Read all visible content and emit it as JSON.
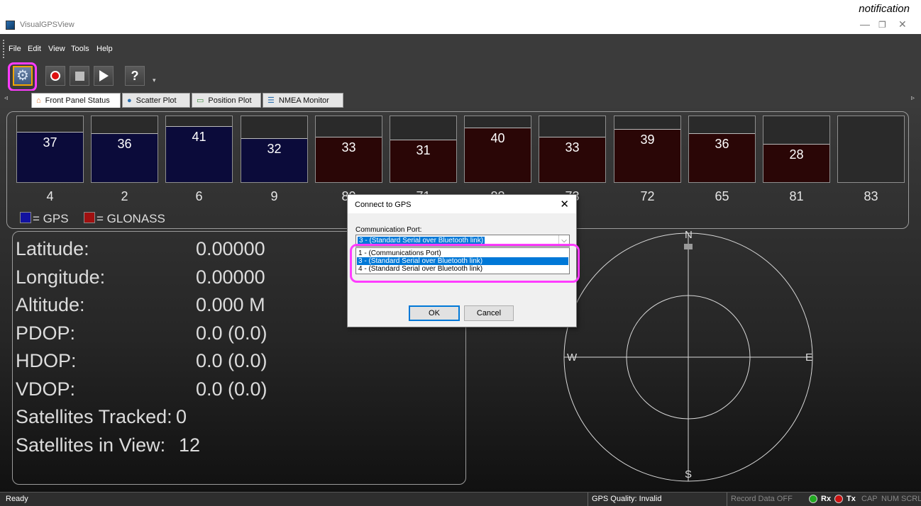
{
  "notification": "notification",
  "window": {
    "title": "VisualGPSView",
    "minimize": "—",
    "restore": "❐",
    "close": "✕"
  },
  "menu": [
    "File",
    "Edit",
    "View",
    "Tools",
    "Help"
  ],
  "toolbar": [
    {
      "name": "settings-icon",
      "glyph": "⚙"
    },
    {
      "name": "record-icon",
      "glyph": "●"
    },
    {
      "name": "stop-icon",
      "glyph": "■"
    },
    {
      "name": "play-icon",
      "glyph": "▶"
    },
    {
      "name": "help-icon",
      "glyph": "?"
    }
  ],
  "tabs": [
    "Front Panel Status",
    "Scatter Plot",
    "Position Plot",
    "NMEA Monitor"
  ],
  "satellites": [
    {
      "id": "4",
      "snr": 37,
      "system": "GPS"
    },
    {
      "id": "2",
      "snr": 36,
      "system": "GPS"
    },
    {
      "id": "6",
      "snr": 41,
      "system": "GPS"
    },
    {
      "id": "9",
      "snr": 32,
      "system": "GPS"
    },
    {
      "id": "80",
      "snr": 33,
      "system": "GLONASS"
    },
    {
      "id": "71",
      "snr": 31,
      "system": "GLONASS"
    },
    {
      "id": "88",
      "snr": 40,
      "system": "GLONASS"
    },
    {
      "id": "73",
      "snr": 33,
      "system": "GLONASS"
    },
    {
      "id": "72",
      "snr": 39,
      "system": "GLONASS"
    },
    {
      "id": "65",
      "snr": 36,
      "system": "GLONASS"
    },
    {
      "id": "81",
      "snr": 28,
      "system": "GLONASS"
    },
    {
      "id": "83",
      "snr": null,
      "system": "GLONASS"
    }
  ],
  "legend": {
    "gps": "= GPS",
    "glonass": "= GLONASS",
    "gps_color": "#0b0b3a",
    "glonass_color": "#2a0606"
  },
  "info": [
    {
      "label": "Latitude:",
      "value": "0.00000"
    },
    {
      "label": "Longitude:",
      "value": "0.00000"
    },
    {
      "label": "Altitude:",
      "value": "0.000 M"
    },
    {
      "label": "PDOP:",
      "value": "0.0 (0.0)"
    },
    {
      "label": "HDOP:",
      "value": "0.0 (0.0)"
    },
    {
      "label": "VDOP:",
      "value": "0.0 (0.0)"
    },
    {
      "label": "Satellites Tracked:",
      "value": "0"
    },
    {
      "label": "Satellites in View:",
      "value": "12"
    }
  ],
  "compass": {
    "n": "N",
    "s": "S",
    "e": "E",
    "w": "W"
  },
  "dialog": {
    "title": "Connect to GPS",
    "close": "✕",
    "port_label": "Communication Port:",
    "selected": "3 - (Standard Serial over Bluetooth link)",
    "options": [
      "1 - (Communications Port)",
      "3 - (Standard Serial over Bluetooth link)",
      "4 - (Standard Serial over Bluetooth link)"
    ],
    "ok": "OK",
    "cancel": "Cancel"
  },
  "status": {
    "ready": "Ready",
    "gps_quality": "GPS Quality: Invalid",
    "record": "Record Data OFF",
    "rx": "Rx",
    "tx": "Tx",
    "cap": "CAP",
    "num": "NUM",
    "scrl": "SCRL"
  },
  "highlight_color": "#ff3cff"
}
